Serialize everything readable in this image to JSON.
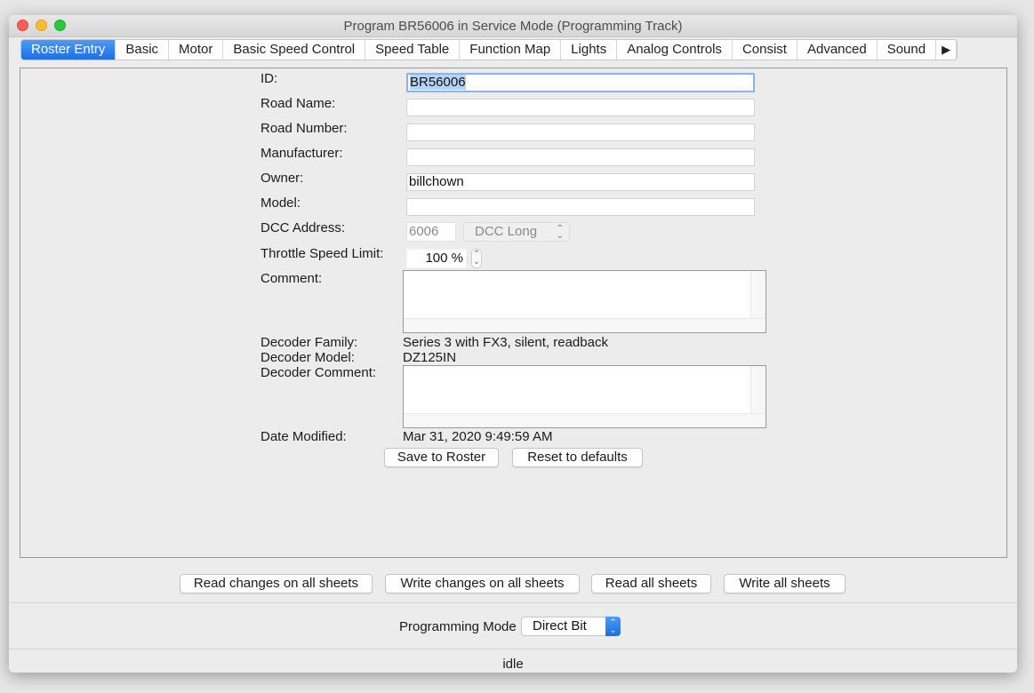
{
  "window": {
    "title": "Program BR56006 in Service Mode (Programming Track)"
  },
  "tabs": [
    {
      "label": "Roster Entry",
      "active": true
    },
    {
      "label": "Basic"
    },
    {
      "label": "Motor"
    },
    {
      "label": "Basic Speed Control"
    },
    {
      "label": "Speed Table"
    },
    {
      "label": "Function Map"
    },
    {
      "label": "Lights"
    },
    {
      "label": "Analog Controls"
    },
    {
      "label": "Consist"
    },
    {
      "label": "Advanced"
    },
    {
      "label": "Sound"
    }
  ],
  "tabs_more_glyph": "▶",
  "form": {
    "id_label": "ID:",
    "id_value": "BR56006",
    "road_name_label": "Road Name:",
    "road_name_value": "",
    "road_number_label": "Road Number:",
    "road_number_value": "",
    "manufacturer_label": "Manufacturer:",
    "manufacturer_value": "",
    "owner_label": "Owner:",
    "owner_value": "billchown",
    "model_label": "Model:",
    "model_value": "",
    "dcc_address_label": "DCC Address:",
    "dcc_address_value": "6006",
    "dcc_address_type": "DCC Long",
    "throttle_limit_label": "Throttle Speed Limit:",
    "throttle_limit_value": "100 %",
    "comment_label": "Comment:",
    "comment_value": "",
    "decoder_family_label": "Decoder Family:",
    "decoder_family_value": "Series 3 with FX3, silent, readback",
    "decoder_model_label": "Decoder Model:",
    "decoder_model_value": "DZ125IN",
    "decoder_comment_label": "Decoder Comment:",
    "decoder_comment_value": "",
    "date_modified_label": "Date Modified:",
    "date_modified_value": "Mar 31, 2020 9:49:59 AM",
    "save_button": "Save to Roster",
    "reset_button": "Reset to defaults"
  },
  "sheet_buttons": {
    "read_changes": "Read changes on all sheets",
    "write_changes": "Write changes on all sheets",
    "read_all": "Read all sheets",
    "write_all": "Write all sheets"
  },
  "programming_mode": {
    "label": "Programming Mode",
    "value": "Direct Bit"
  },
  "status": "idle",
  "icons": {
    "updown": "⌃⌄",
    "more": "▶"
  }
}
